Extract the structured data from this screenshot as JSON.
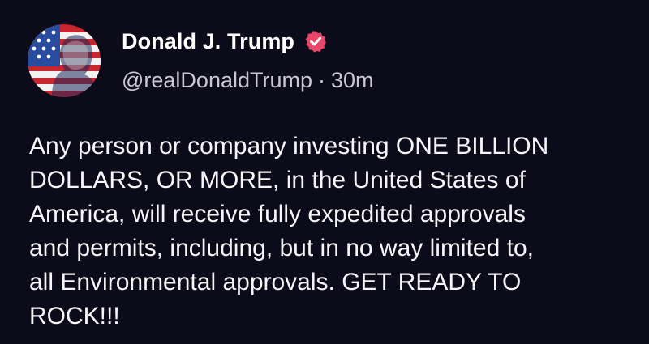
{
  "post": {
    "author": {
      "display_name": "Donald J. Trump",
      "handle": "@realDonaldTrump",
      "verified": true,
      "avatar_icon": "flag-portrait-avatar"
    },
    "separator": "·",
    "time": "30m",
    "text": "Any person or company investing ONE BILLION\nDOLLARS, OR MORE, in the United States of\nAmerica, will receive fully expedited approvals\nand permits, including, but in no way limited to,\nall Environmental approvals. GET READY TO\nROCK!!!"
  },
  "colors": {
    "background": "#0c0b1a",
    "verified_badge": "#e8476b",
    "text": "#f6f6f8",
    "muted": "#c9c6d6"
  }
}
